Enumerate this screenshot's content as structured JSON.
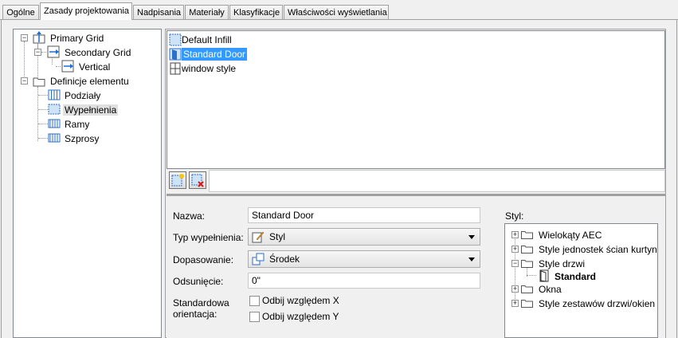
{
  "tabs": [
    {
      "label": "Ogólne",
      "active": false
    },
    {
      "label": "Zasady projektowania",
      "active": true
    },
    {
      "label": "Nadpisania",
      "active": false
    },
    {
      "label": "Materiały",
      "active": false
    },
    {
      "label": "Klasyfikacje",
      "active": false
    },
    {
      "label": "Właściwości wyświetlania",
      "active": false
    }
  ],
  "tree": {
    "primary_grid": "Primary Grid",
    "secondary_grid": "Secondary Grid",
    "vertical": "Vertical",
    "element_definitions": "Definicje elementu",
    "divisions": "Podziały",
    "infills": "Wypełnienia",
    "frames": "Ramy",
    "mullions": "Szprosy"
  },
  "infill_list": {
    "items": [
      "Default Infill",
      "Standard Door",
      "window style"
    ],
    "selected": "Standard Door"
  },
  "toolbar": {
    "new_icon": "new-infill-icon",
    "delete_icon": "delete-infill-icon"
  },
  "props": {
    "name_label": "Nazwa:",
    "name_value": "Standard Door",
    "infill_type_label": "Typ wypełnienia:",
    "infill_type_value": "Styl",
    "alignment_label": "Dopasowanie:",
    "alignment_value": "Środek",
    "offset_label": "Odsunięcie:",
    "offset_value": "0\"",
    "orientation_label_1": "Standardowa",
    "orientation_label_2": "orientacja:",
    "flip_x_label": "Odbij względem X",
    "flip_y_label": "Odbij względem Y",
    "flip_x_checked": false,
    "flip_y_checked": false
  },
  "style": {
    "label": "Styl:",
    "items": [
      "Wielokąty AEC",
      "Style jednostek ścian kurtynowych",
      "Style drzwi",
      "Standard",
      "Okna",
      "Style zestawów drzwi/okien"
    ],
    "selected": "Standard"
  },
  "colors": {
    "selection": "#3399ff",
    "border": "#828790"
  }
}
